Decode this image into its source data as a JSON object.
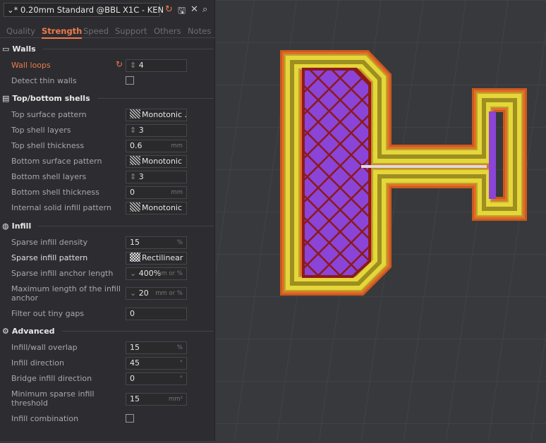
{
  "header": {
    "preset": "* 0.20mm Standard @BBL X1C - KEN",
    "icons": [
      "reset-icon",
      "save-icon",
      "close-icon",
      "search-icon"
    ]
  },
  "tabs": [
    "Quality",
    "Strength",
    "Speed",
    "Support",
    "Others",
    "Notes"
  ],
  "active_tab": "Strength",
  "accent": "#f07a4a",
  "sections": {
    "walls": {
      "title": "Walls",
      "wall_loops": {
        "label": "Wall loops",
        "value": "4"
      },
      "detect_thin": {
        "label": "Detect thin walls",
        "checked": false
      }
    },
    "shells": {
      "title": "Top/bottom shells",
      "top_pattern": {
        "label": "Top surface pattern",
        "value": "Monotonic ..."
      },
      "top_layers": {
        "label": "Top shell layers",
        "value": "3"
      },
      "top_thickness": {
        "label": "Top shell thickness",
        "value": "0.6",
        "unit": "mm"
      },
      "bottom_pattern": {
        "label": "Bottom surface pattern",
        "value": "Monotonic"
      },
      "bottom_layers": {
        "label": "Bottom shell layers",
        "value": "3"
      },
      "bottom_thickness": {
        "label": "Bottom shell thickness",
        "value": "0",
        "unit": "mm"
      },
      "internal_pattern": {
        "label": "Internal solid infill pattern",
        "value": "Monotonic"
      }
    },
    "infill": {
      "title": "Infill",
      "density": {
        "label": "Sparse infill density",
        "value": "15",
        "unit": "%"
      },
      "pattern": {
        "label": "Sparse infill pattern",
        "value": "Rectilinear"
      },
      "anchor": {
        "label": "Sparse infill anchor length",
        "value": "400%",
        "unit": "mm or %"
      },
      "anchor_max": {
        "label": "Maximum length of the infill anchor",
        "value": "20",
        "unit": "mm or %"
      },
      "gaps": {
        "label": "Filter out tiny gaps",
        "value": "0"
      }
    },
    "advanced": {
      "title": "Advanced",
      "overlap": {
        "label": "Infill/wall overlap",
        "value": "15",
        "unit": "%"
      },
      "direction": {
        "label": "Infill direction",
        "value": "45",
        "unit": "°"
      },
      "bridge": {
        "label": "Bridge infill direction",
        "value": "0",
        "unit": "°"
      },
      "min_sparse": {
        "label": "Minimum sparse infill threshold",
        "value": "15",
        "unit": "mm²"
      },
      "combination": {
        "label": "Infill combination",
        "checked": false
      }
    }
  }
}
